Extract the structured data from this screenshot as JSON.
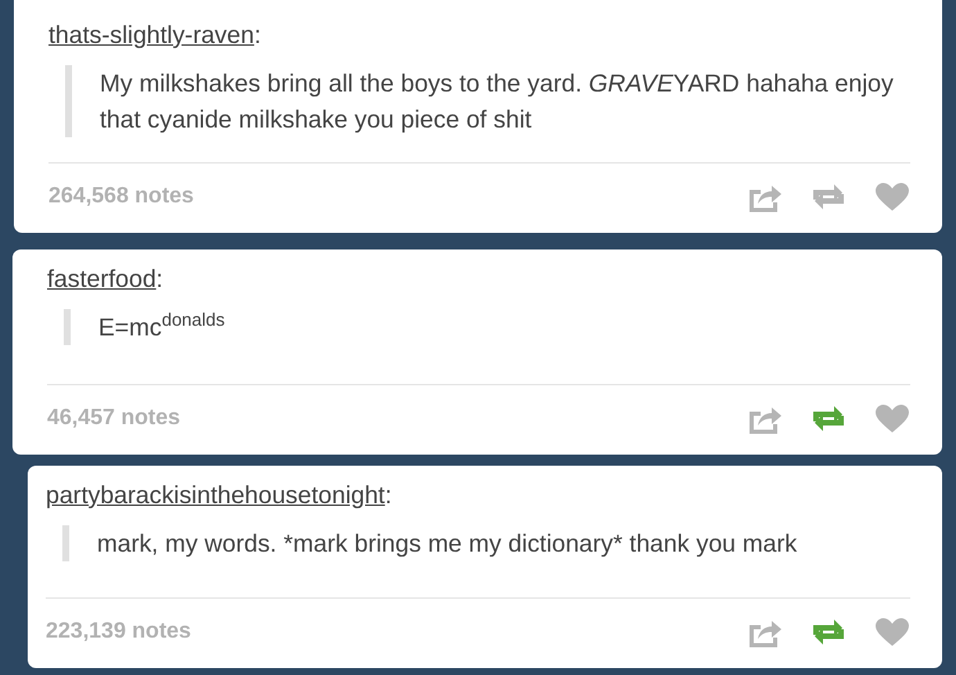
{
  "posts": [
    {
      "author": "thats-slightly-raven",
      "suffix": ":",
      "text": [
        {
          "text": "My milkshakes bring all the boys to the yard. ",
          "kind": "plain"
        },
        {
          "text": "GRAVE",
          "kind": "italic"
        },
        {
          "text": "YARD hahaha enjoy that cyanide milkshake you piece of shit",
          "kind": "plain"
        }
      ],
      "notes": "264,568 notes",
      "reblogged": false,
      "liked": false
    },
    {
      "author": "fasterfood",
      "suffix": ":",
      "text": [
        {
          "text": "E=mc",
          "kind": "plain"
        },
        {
          "text": "donalds",
          "kind": "sup"
        }
      ],
      "notes": "46,457 notes",
      "reblogged": true,
      "liked": false
    },
    {
      "author": "partybarackisinthehousetonight",
      "suffix": ":",
      "text": [
        {
          "text": "mark, my words. *mark brings me my dictionary* thank you mark",
          "kind": "plain"
        }
      ],
      "notes": "223,139 notes",
      "reblogged": true,
      "liked": false
    }
  ]
}
